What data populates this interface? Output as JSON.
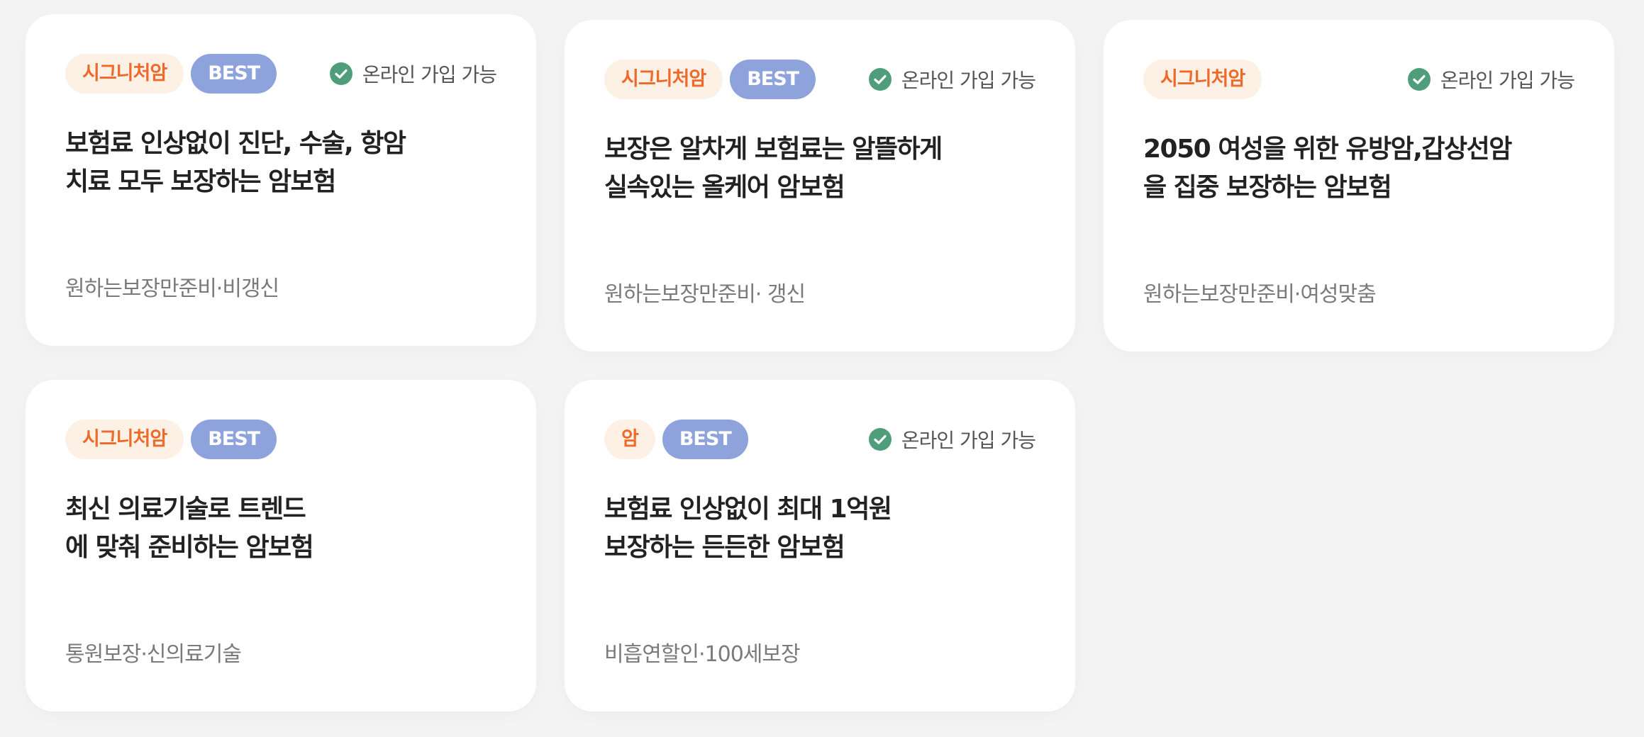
{
  "online_label": "온라인 가입 가능",
  "colors": {
    "category_bg": "#fdf0e5",
    "category_text": "#ee6a2b",
    "best_bg": "#8ea3dc",
    "check_green": "#4f9d7a"
  },
  "cards": [
    {
      "category": "시그니처암",
      "best": "BEST",
      "title_lines": [
        "보험료 인상없이 진단, 수술, 항암",
        "치료 모두 보장하는 암보험"
      ],
      "tags": "원하는보장만준비·비갱신",
      "online": true
    },
    {
      "category": "시그니처암",
      "best": "BEST",
      "title_lines": [
        "보장은 알차게 보험료는 알뜰하게",
        "실속있는 올케어 암보험"
      ],
      "tags": "원하는보장만준비· 갱신",
      "online": true
    },
    {
      "category": "시그니처암",
      "best": "",
      "title_lines": [
        "2050 여성을 위한 유방암,갑상선암",
        "을 집중 보장하는 암보험"
      ],
      "tags": "원하는보장만준비·여성맞춤",
      "online": true
    },
    {
      "category": "시그니처암",
      "best": "BEST",
      "title_lines": [
        "최신 의료기술로 트렌드",
        "에 맞춰 준비하는 암보험"
      ],
      "tags": "통원보장·신의료기술",
      "online": false
    },
    {
      "category": "암",
      "best": "BEST",
      "title_lines": [
        "보험료 인상없이 최대 1억원",
        "보장하는 든든한 암보험"
      ],
      "tags": "비흡연할인·100세보장",
      "online": true
    }
  ]
}
